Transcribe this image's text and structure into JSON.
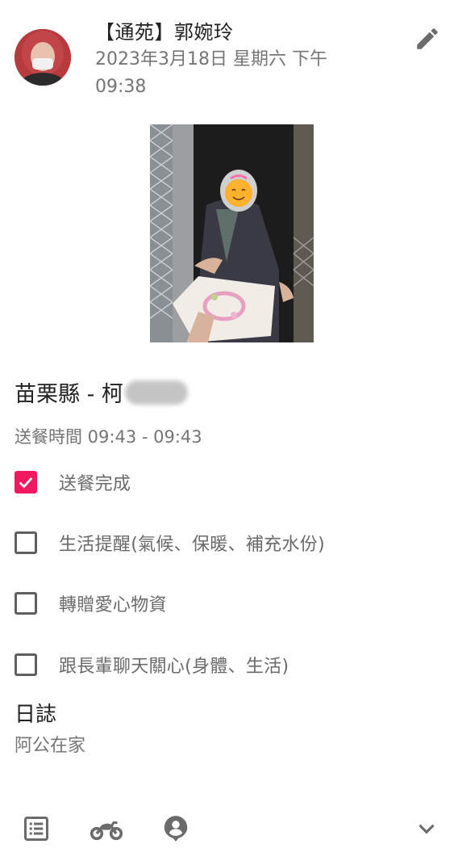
{
  "post": {
    "author": "【通苑】郭婉玲",
    "timestamp": "2023年3月18日 星期六 下午09:38"
  },
  "record": {
    "location": "苗栗縣 - 柯",
    "delivery_time": "送餐時間 09:43 - 09:43"
  },
  "checklist": [
    {
      "label": "送餐完成",
      "checked": true
    },
    {
      "label": "生活提醒(氣候、保暖、補充水份)",
      "checked": false
    },
    {
      "label": "轉贈愛心物資",
      "checked": false
    },
    {
      "label": "跟長輩聊天關心(身體、生活)",
      "checked": false
    }
  ],
  "log": {
    "title": "日誌",
    "text": "阿公在家"
  },
  "colors": {
    "accent": "#f2185f",
    "icon_gray": "#6b6b6b",
    "secondary_text": "#757575"
  },
  "icons": {
    "edit": "pencil-icon",
    "list": "list-icon",
    "transport": "motorcycle-icon",
    "person": "person-pin-icon",
    "expand": "chevron-down-icon"
  }
}
